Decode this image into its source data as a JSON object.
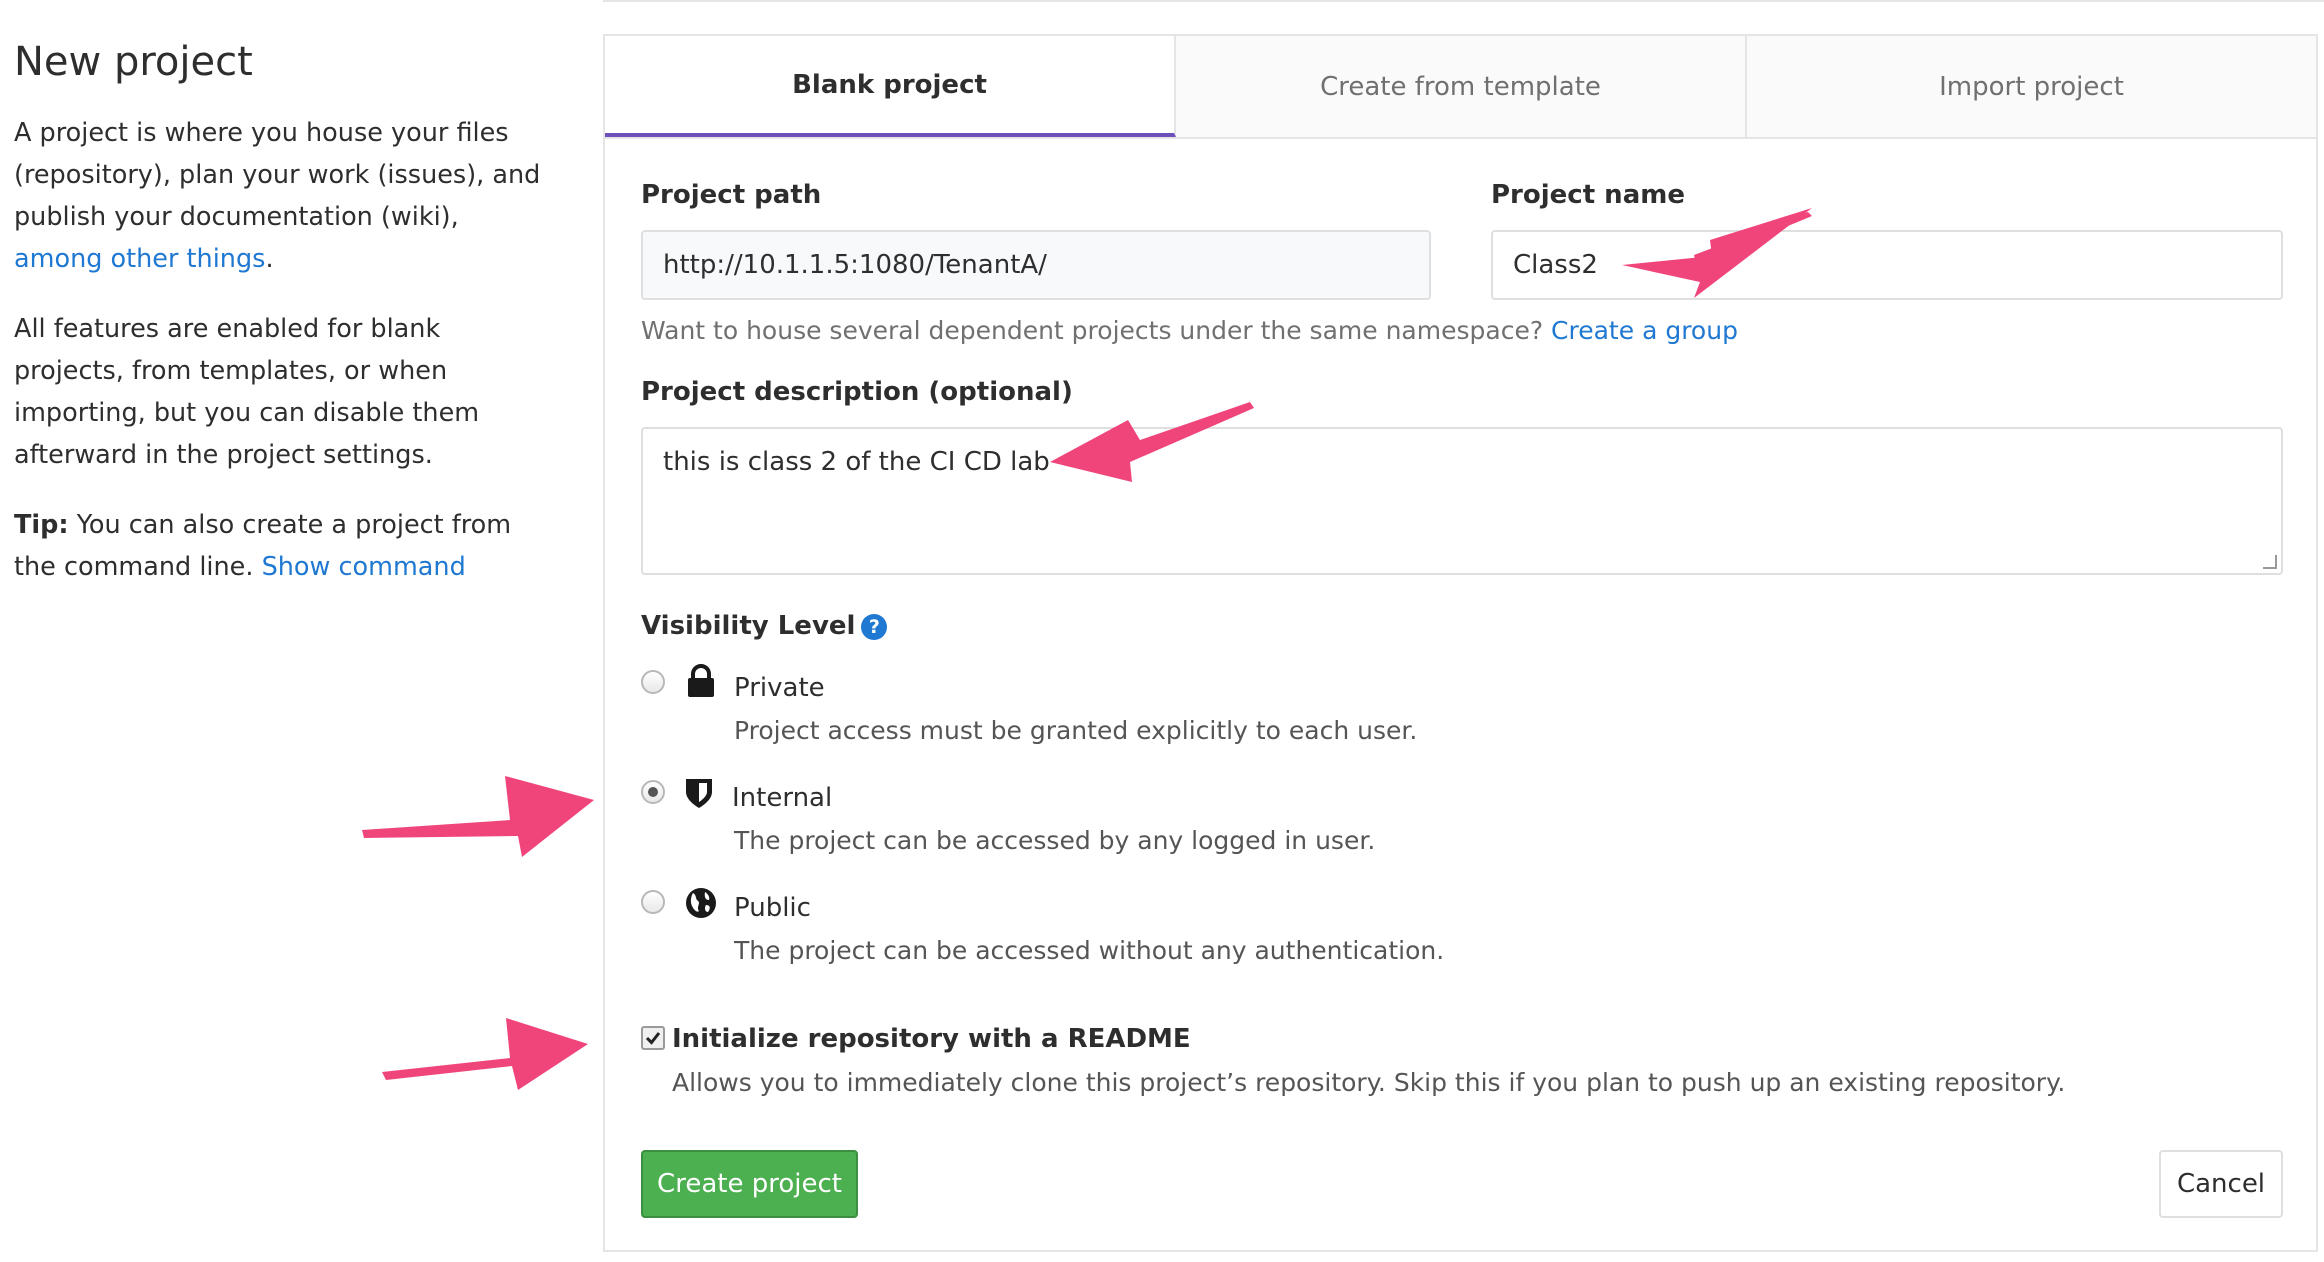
{
  "sidebar": {
    "title": "New project",
    "intro_text": "A project is where you house your files (repository), plan your work (issues), and publish your documentation (wiki), ",
    "intro_link": "among other things",
    "intro_end": ".",
    "features_text": "All features are enabled for blank projects, from templates, or when importing, but you can disable them afterward in the project settings.",
    "tip_label": "Tip:",
    "tip_text": " You can also create a project from the command line. ",
    "tip_link": "Show command"
  },
  "tabs": [
    {
      "label": "Blank project",
      "active": true
    },
    {
      "label": "Create from template",
      "active": false
    },
    {
      "label": "Import project",
      "active": false
    }
  ],
  "form": {
    "project_path_label": "Project path",
    "project_path_value": "http://10.1.1.5:1080/TenantA/",
    "project_name_label": "Project name",
    "project_name_value": "Class2",
    "namespace_help": "Want to house several dependent projects under the same namespace? ",
    "namespace_link": "Create a group",
    "description_label": "Project description (optional)",
    "description_value": "this is class 2 of the CI CD lab",
    "visibility_label": "Visibility Level",
    "visibility_options": [
      {
        "label": "Private",
        "description": "Project access must be granted explicitly to each user.",
        "icon": "lock-icon",
        "checked": false
      },
      {
        "label": "Internal",
        "description": "The project can be accessed by any logged in user.",
        "icon": "shield-icon",
        "checked": true
      },
      {
        "label": "Public",
        "description": "The project can be accessed without any authentication.",
        "icon": "globe-icon",
        "checked": false
      }
    ],
    "readme_label": "Initialize repository with a README",
    "readme_checked": true,
    "readme_help": "Allows you to immediately clone this project’s repository. Skip this if you plan to push up an existing repository.",
    "create_button": "Create project",
    "cancel_button": "Cancel"
  },
  "colors": {
    "link": "#1f78d1",
    "active_tab_underline": "#6b4fbb",
    "create_button": "#4caf50",
    "annotation_arrow": "#f0457a"
  }
}
